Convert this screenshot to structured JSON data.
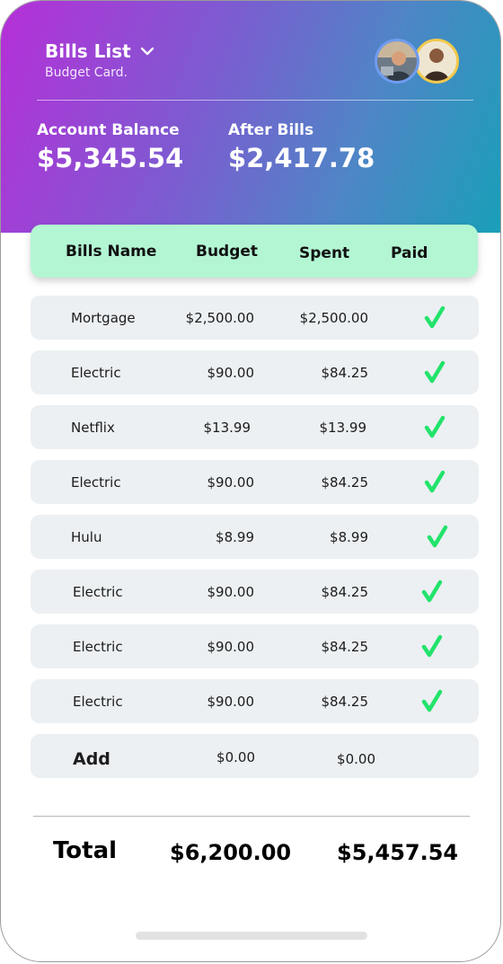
{
  "header": {
    "title": "Bills List",
    "subtitle": "Budget Card.",
    "account_balance_label": "Account Balance",
    "account_balance_value": "$5,345.54",
    "after_bills_label": "After Bills",
    "after_bills_value": "$2,417.78"
  },
  "columns": {
    "name": "Bills Name",
    "budget": "Budget",
    "spent": "Spent",
    "paid": "Paid"
  },
  "bills": [
    {
      "name": "Mortgage",
      "budget": "$2,500.00",
      "spent": "$2,500.00",
      "paid": true
    },
    {
      "name": "Electric",
      "budget": "$90.00",
      "spent": "$84.25",
      "paid": true
    },
    {
      "name": "Netflix",
      "budget": "$13.99",
      "spent": "$13.99",
      "paid": true
    },
    {
      "name": "Electric",
      "budget": "$90.00",
      "spent": "$84.25",
      "paid": true
    },
    {
      "name": "Hulu",
      "budget": "$8.99",
      "spent": "$8.99",
      "paid": true
    },
    {
      "name": "Electric",
      "budget": "$90.00",
      "spent": "$84.25",
      "paid": true
    },
    {
      "name": "Electric",
      "budget": "$90.00",
      "spent": "$84.25",
      "paid": true
    },
    {
      "name": "Electric",
      "budget": "$90.00",
      "spent": "$84.25",
      "paid": true
    }
  ],
  "add_row": {
    "label": "Add",
    "budget": "$0.00",
    "spent": "$0.00"
  },
  "totals": {
    "label": "Total",
    "budget": "$6,200.00",
    "spent": "$5,457.54"
  },
  "colors": {
    "header_gradient_start": "#b62fd8",
    "header_gradient_end": "#1a9fb9",
    "column_header_bg": "#b3f6d3",
    "check_green": "#22e36b",
    "row_bg": "#ecf0f3"
  },
  "icons": {
    "dropdown": "chevron-down-icon",
    "paid": "checkmark-icon",
    "avatars": [
      "avatar-user-1",
      "avatar-user-2"
    ]
  }
}
